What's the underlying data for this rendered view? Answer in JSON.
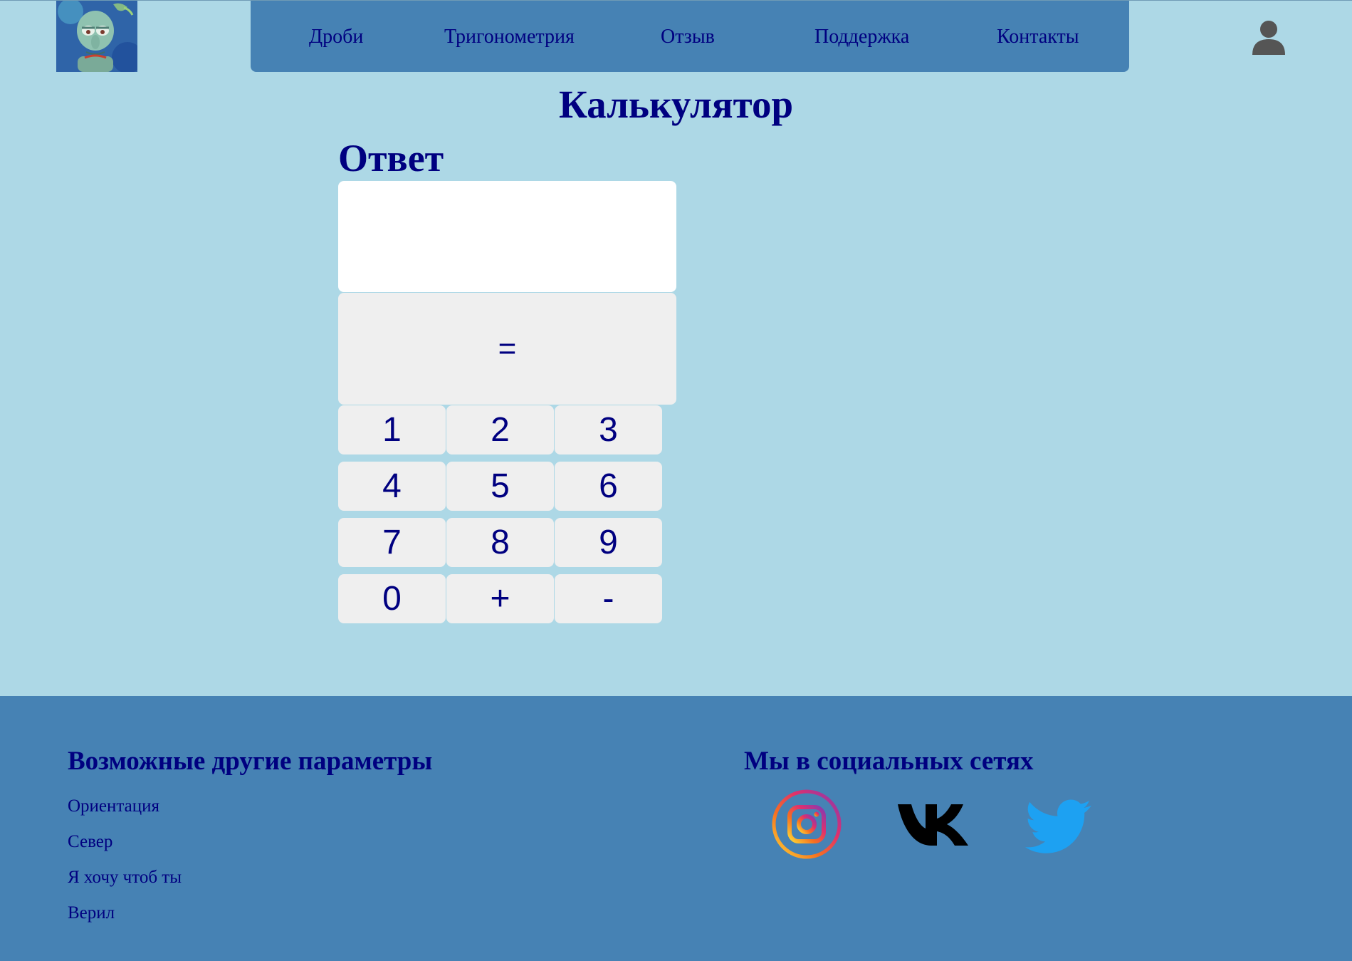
{
  "header": {
    "logo_icon": "squidward-avatar-logo",
    "user_icon": "user-profile-icon",
    "nav": [
      {
        "label": "Дроби"
      },
      {
        "label": "Тригонометрия"
      },
      {
        "label": "Отзыв"
      },
      {
        "label": "Поддержка"
      },
      {
        "label": "Контакты"
      }
    ]
  },
  "main": {
    "title": "Калькулятор",
    "answer_label": "Ответ",
    "answer_value": "",
    "equals_label": "=",
    "keys": [
      "1",
      "2",
      "3",
      "4",
      "5",
      "6",
      "7",
      "8",
      "9",
      "0",
      "+",
      "-"
    ]
  },
  "footer": {
    "params_heading": "Возможные другие параметры",
    "params_links": [
      "Ориентация",
      "Север",
      "Я хочу чтоб ты",
      "Верил"
    ],
    "social_heading": "Мы в социальных сетях",
    "social_icons": [
      "instagram-icon",
      "vk-icon",
      "twitter-icon"
    ]
  },
  "colors": {
    "page_background": "#add8e6",
    "nav_background": "#4682b4",
    "text": "#000080",
    "button_background": "#efefef",
    "display_background": "#ffffff"
  }
}
